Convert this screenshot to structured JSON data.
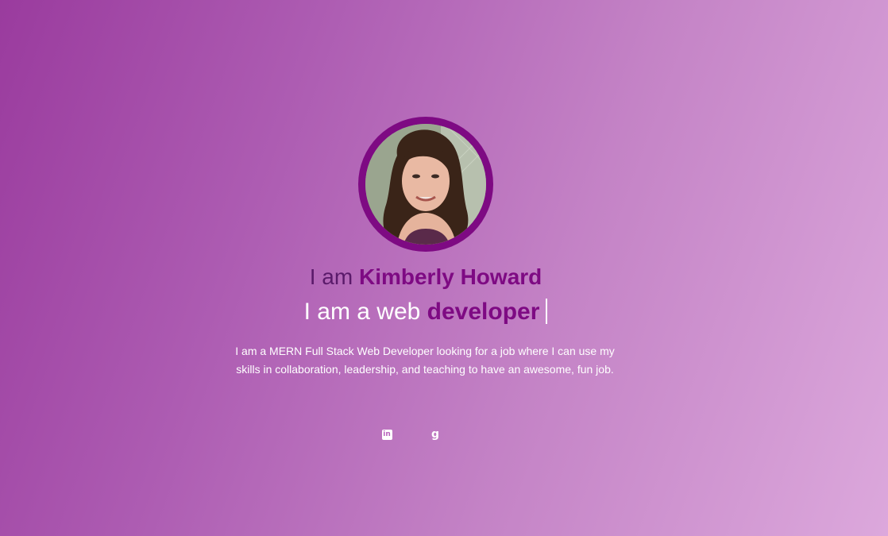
{
  "hero": {
    "avatar_alt": "Kimberly Howard profile photo",
    "intro_prefix": "I am",
    "name": "Kimberly Howard",
    "role_prefix": "I am a web",
    "role": "developer",
    "bio": "I am a MERN Full Stack Web Developer looking for a job where I can use my skills in collaboration, leadership, and teaching to have an awesome, fun job."
  },
  "social": {
    "linkedin_icon": "linkedin-icon",
    "linkedin_glyph": "in",
    "github_icon": "github-icon",
    "github_glyph": "g"
  },
  "colors": {
    "accent": "#7e0a83",
    "gradient_start": "#9a3b9e",
    "gradient_end": "#dca8dc",
    "text_light": "#ffffff",
    "intro_text": "#5a1a6a"
  }
}
